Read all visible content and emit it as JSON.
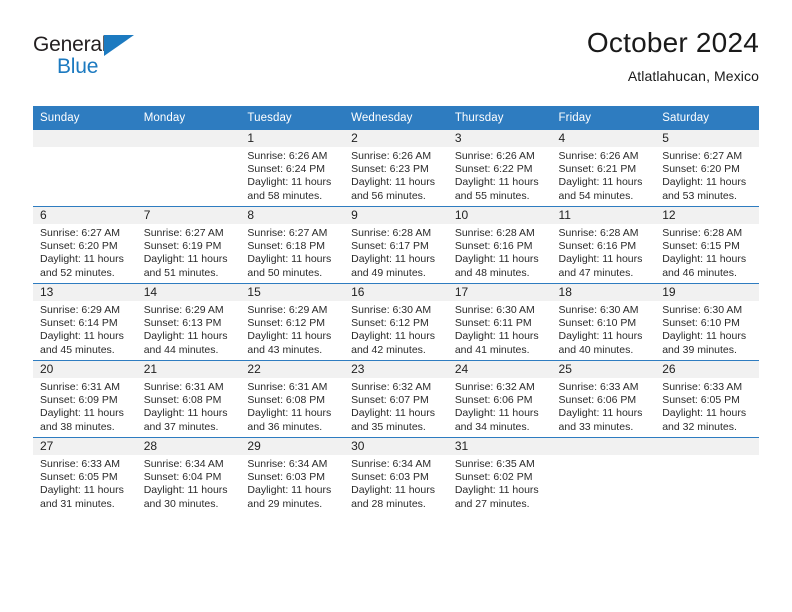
{
  "brand": {
    "name_part1": "General",
    "name_part2": "Blue",
    "color_primary": "#1c7ac0",
    "color_text": "#231f20"
  },
  "header": {
    "month_title": "October 2024",
    "location": "Atlatlahucan, Mexico"
  },
  "theme": {
    "header_bg": "#2e7cc0",
    "header_text": "#ffffff",
    "day_band_bg": "#f1f1f1",
    "row_border": "#2e7cc0"
  },
  "weekday_headers": [
    "Sunday",
    "Monday",
    "Tuesday",
    "Wednesday",
    "Thursday",
    "Friday",
    "Saturday"
  ],
  "labels": {
    "sunrise_prefix": "Sunrise:",
    "sunset_prefix": "Sunset:",
    "daylight_prefix": "Daylight:"
  },
  "weeks": [
    [
      {
        "day": "",
        "sunrise": "",
        "sunset": "",
        "daylight_line1": "",
        "daylight_line2": ""
      },
      {
        "day": "",
        "sunrise": "",
        "sunset": "",
        "daylight_line1": "",
        "daylight_line2": ""
      },
      {
        "day": "1",
        "sunrise": "Sunrise: 6:26 AM",
        "sunset": "Sunset: 6:24 PM",
        "daylight_line1": "Daylight: 11 hours",
        "daylight_line2": "and 58 minutes."
      },
      {
        "day": "2",
        "sunrise": "Sunrise: 6:26 AM",
        "sunset": "Sunset: 6:23 PM",
        "daylight_line1": "Daylight: 11 hours",
        "daylight_line2": "and 56 minutes."
      },
      {
        "day": "3",
        "sunrise": "Sunrise: 6:26 AM",
        "sunset": "Sunset: 6:22 PM",
        "daylight_line1": "Daylight: 11 hours",
        "daylight_line2": "and 55 minutes."
      },
      {
        "day": "4",
        "sunrise": "Sunrise: 6:26 AM",
        "sunset": "Sunset: 6:21 PM",
        "daylight_line1": "Daylight: 11 hours",
        "daylight_line2": "and 54 minutes."
      },
      {
        "day": "5",
        "sunrise": "Sunrise: 6:27 AM",
        "sunset": "Sunset: 6:20 PM",
        "daylight_line1": "Daylight: 11 hours",
        "daylight_line2": "and 53 minutes."
      }
    ],
    [
      {
        "day": "6",
        "sunrise": "Sunrise: 6:27 AM",
        "sunset": "Sunset: 6:20 PM",
        "daylight_line1": "Daylight: 11 hours",
        "daylight_line2": "and 52 minutes."
      },
      {
        "day": "7",
        "sunrise": "Sunrise: 6:27 AM",
        "sunset": "Sunset: 6:19 PM",
        "daylight_line1": "Daylight: 11 hours",
        "daylight_line2": "and 51 minutes."
      },
      {
        "day": "8",
        "sunrise": "Sunrise: 6:27 AM",
        "sunset": "Sunset: 6:18 PM",
        "daylight_line1": "Daylight: 11 hours",
        "daylight_line2": "and 50 minutes."
      },
      {
        "day": "9",
        "sunrise": "Sunrise: 6:28 AM",
        "sunset": "Sunset: 6:17 PM",
        "daylight_line1": "Daylight: 11 hours",
        "daylight_line2": "and 49 minutes."
      },
      {
        "day": "10",
        "sunrise": "Sunrise: 6:28 AM",
        "sunset": "Sunset: 6:16 PM",
        "daylight_line1": "Daylight: 11 hours",
        "daylight_line2": "and 48 minutes."
      },
      {
        "day": "11",
        "sunrise": "Sunrise: 6:28 AM",
        "sunset": "Sunset: 6:16 PM",
        "daylight_line1": "Daylight: 11 hours",
        "daylight_line2": "and 47 minutes."
      },
      {
        "day": "12",
        "sunrise": "Sunrise: 6:28 AM",
        "sunset": "Sunset: 6:15 PM",
        "daylight_line1": "Daylight: 11 hours",
        "daylight_line2": "and 46 minutes."
      }
    ],
    [
      {
        "day": "13",
        "sunrise": "Sunrise: 6:29 AM",
        "sunset": "Sunset: 6:14 PM",
        "daylight_line1": "Daylight: 11 hours",
        "daylight_line2": "and 45 minutes."
      },
      {
        "day": "14",
        "sunrise": "Sunrise: 6:29 AM",
        "sunset": "Sunset: 6:13 PM",
        "daylight_line1": "Daylight: 11 hours",
        "daylight_line2": "and 44 minutes."
      },
      {
        "day": "15",
        "sunrise": "Sunrise: 6:29 AM",
        "sunset": "Sunset: 6:12 PM",
        "daylight_line1": "Daylight: 11 hours",
        "daylight_line2": "and 43 minutes."
      },
      {
        "day": "16",
        "sunrise": "Sunrise: 6:30 AM",
        "sunset": "Sunset: 6:12 PM",
        "daylight_line1": "Daylight: 11 hours",
        "daylight_line2": "and 42 minutes."
      },
      {
        "day": "17",
        "sunrise": "Sunrise: 6:30 AM",
        "sunset": "Sunset: 6:11 PM",
        "daylight_line1": "Daylight: 11 hours",
        "daylight_line2": "and 41 minutes."
      },
      {
        "day": "18",
        "sunrise": "Sunrise: 6:30 AM",
        "sunset": "Sunset: 6:10 PM",
        "daylight_line1": "Daylight: 11 hours",
        "daylight_line2": "and 40 minutes."
      },
      {
        "day": "19",
        "sunrise": "Sunrise: 6:30 AM",
        "sunset": "Sunset: 6:10 PM",
        "daylight_line1": "Daylight: 11 hours",
        "daylight_line2": "and 39 minutes."
      }
    ],
    [
      {
        "day": "20",
        "sunrise": "Sunrise: 6:31 AM",
        "sunset": "Sunset: 6:09 PM",
        "daylight_line1": "Daylight: 11 hours",
        "daylight_line2": "and 38 minutes."
      },
      {
        "day": "21",
        "sunrise": "Sunrise: 6:31 AM",
        "sunset": "Sunset: 6:08 PM",
        "daylight_line1": "Daylight: 11 hours",
        "daylight_line2": "and 37 minutes."
      },
      {
        "day": "22",
        "sunrise": "Sunrise: 6:31 AM",
        "sunset": "Sunset: 6:08 PM",
        "daylight_line1": "Daylight: 11 hours",
        "daylight_line2": "and 36 minutes."
      },
      {
        "day": "23",
        "sunrise": "Sunrise: 6:32 AM",
        "sunset": "Sunset: 6:07 PM",
        "daylight_line1": "Daylight: 11 hours",
        "daylight_line2": "and 35 minutes."
      },
      {
        "day": "24",
        "sunrise": "Sunrise: 6:32 AM",
        "sunset": "Sunset: 6:06 PM",
        "daylight_line1": "Daylight: 11 hours",
        "daylight_line2": "and 34 minutes."
      },
      {
        "day": "25",
        "sunrise": "Sunrise: 6:33 AM",
        "sunset": "Sunset: 6:06 PM",
        "daylight_line1": "Daylight: 11 hours",
        "daylight_line2": "and 33 minutes."
      },
      {
        "day": "26",
        "sunrise": "Sunrise: 6:33 AM",
        "sunset": "Sunset: 6:05 PM",
        "daylight_line1": "Daylight: 11 hours",
        "daylight_line2": "and 32 minutes."
      }
    ],
    [
      {
        "day": "27",
        "sunrise": "Sunrise: 6:33 AM",
        "sunset": "Sunset: 6:05 PM",
        "daylight_line1": "Daylight: 11 hours",
        "daylight_line2": "and 31 minutes."
      },
      {
        "day": "28",
        "sunrise": "Sunrise: 6:34 AM",
        "sunset": "Sunset: 6:04 PM",
        "daylight_line1": "Daylight: 11 hours",
        "daylight_line2": "and 30 minutes."
      },
      {
        "day": "29",
        "sunrise": "Sunrise: 6:34 AM",
        "sunset": "Sunset: 6:03 PM",
        "daylight_line1": "Daylight: 11 hours",
        "daylight_line2": "and 29 minutes."
      },
      {
        "day": "30",
        "sunrise": "Sunrise: 6:34 AM",
        "sunset": "Sunset: 6:03 PM",
        "daylight_line1": "Daylight: 11 hours",
        "daylight_line2": "and 28 minutes."
      },
      {
        "day": "31",
        "sunrise": "Sunrise: 6:35 AM",
        "sunset": "Sunset: 6:02 PM",
        "daylight_line1": "Daylight: 11 hours",
        "daylight_line2": "and 27 minutes."
      },
      {
        "day": "",
        "sunrise": "",
        "sunset": "",
        "daylight_line1": "",
        "daylight_line2": ""
      },
      {
        "day": "",
        "sunrise": "",
        "sunset": "",
        "daylight_line1": "",
        "daylight_line2": ""
      }
    ]
  ]
}
